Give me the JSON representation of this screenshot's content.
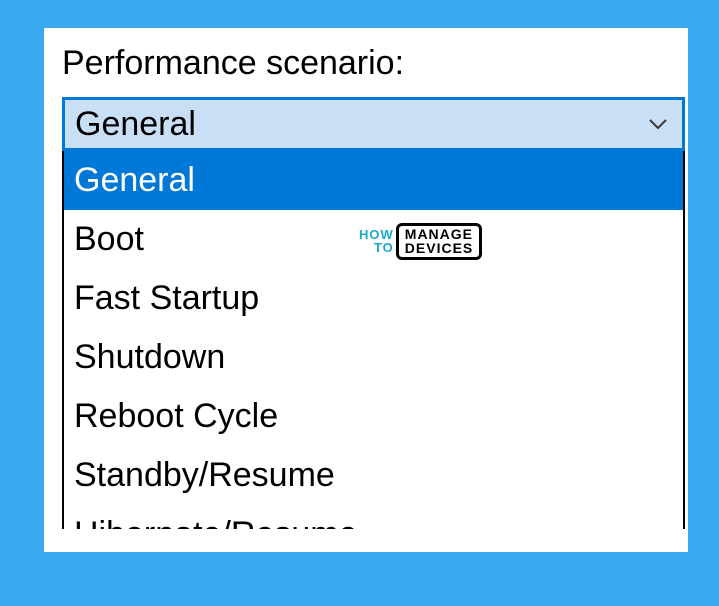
{
  "label": "Performance scenario:",
  "combo": {
    "selected": "General",
    "options": [
      "General",
      "Boot",
      "Fast Startup",
      "Shutdown",
      "Reboot Cycle",
      "Standby/Resume",
      "Hibernate/Resume"
    ],
    "highlighted_index": 0
  },
  "watermark": {
    "left_top": "HOW",
    "left_bottom": "TO",
    "box_top": "MANAGE",
    "box_bottom": "DEVICES"
  }
}
